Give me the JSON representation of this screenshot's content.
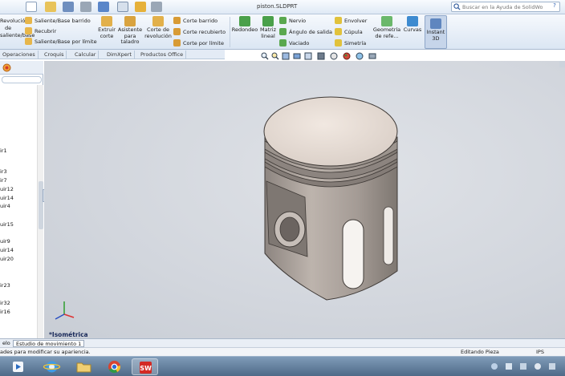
{
  "window": {
    "doc_title": "piston.SLDPRT",
    "search_placeholder": "Buscar en la Ayuda de SolidWorks",
    "help_glyph": "?"
  },
  "ribbon": {
    "left_labels": [
      "Revolución",
      "de",
      "saliente/base"
    ],
    "col1": [
      "Saliente/Base barrido",
      "Recubrir",
      "Saliente/Base por límite"
    ],
    "extrude_cut": "Extruir corte",
    "hole_wizard": "Asistente para taladro",
    "revolve_cut": "Corte de revolución",
    "col2": [
      "Corte barrido",
      "Corte recubierto",
      "Corte por límite"
    ],
    "fillet": "Redondeo",
    "linear_pattern": "Matriz lineal",
    "col3": [
      "Nervio",
      "Ángulo de salida",
      "Vaciado"
    ],
    "col4": [
      "Envolver",
      "Cúpula",
      "Simetría"
    ],
    "ref_geometry": "Geometría de refe...",
    "curves": "Curvas",
    "instant3d": "Instant 3D"
  },
  "command_tabs": [
    "Operaciones",
    "Croquis",
    "Calcular",
    "DimXpert",
    "Productos Office"
  ],
  "feature_tree": {
    "items": [
      "ir1",
      "ir3",
      "ir7",
      "uir12",
      "uir14",
      "uir4",
      "uir15",
      "uir9",
      "uir14",
      "uir20",
      "ir23",
      "ir32",
      "ir16"
    ]
  },
  "viewport": {
    "view_name": "*Isométrica"
  },
  "bottom_tabs": [
    "elo",
    "Estudio de movimiento 1"
  ],
  "status": {
    "message": "ades para modificar su apariencia.",
    "mode": "Editando Pieza",
    "units": "IPS"
  },
  "colors": {
    "viewport_bg": "#d2d6dd",
    "part_body": "#a59d97",
    "part_top": "#e6dcd5",
    "ribbon_bg": "#dbe6f3",
    "taskbar": "#4f6a88",
    "instant3d_active": "#c6d5ea"
  },
  "icons": {
    "search": "magnifier-icon",
    "triad": "axis-triad-icon",
    "ie": "internet-explorer-icon",
    "explorer": "folder-icon",
    "chrome": "chrome-icon",
    "solidworks": "solidworks-icon",
    "media": "media-player-icon"
  }
}
